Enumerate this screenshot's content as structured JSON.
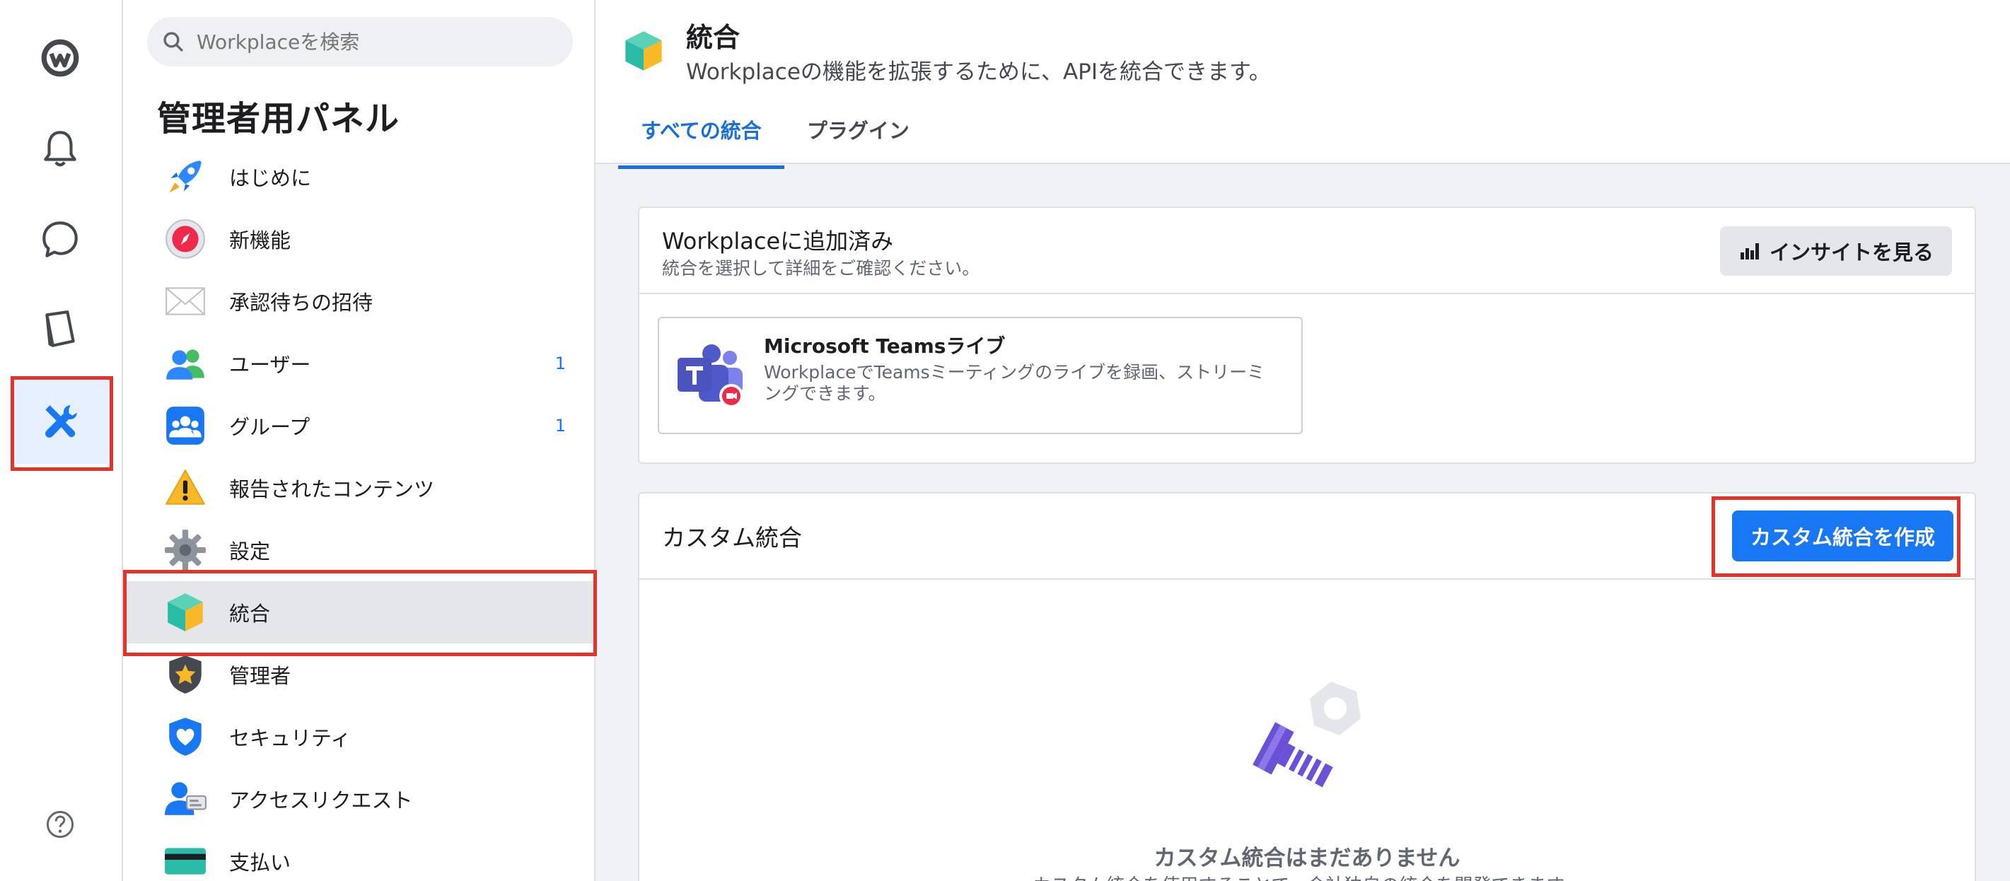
{
  "search": {
    "placeholder": "Workplaceを検索"
  },
  "sidebar": {
    "title": "管理者用パネル",
    "items": [
      {
        "label": "はじめに",
        "icon": "rocket-icon",
        "count": ""
      },
      {
        "label": "新機能",
        "icon": "compass-icon",
        "count": ""
      },
      {
        "label": "承認待ちの招待",
        "icon": "envelope-icon",
        "count": ""
      },
      {
        "label": "ユーザー",
        "icon": "users-icon",
        "count": "1"
      },
      {
        "label": "グループ",
        "icon": "group-icon",
        "count": "1"
      },
      {
        "label": "報告されたコンテンツ",
        "icon": "warning-icon",
        "count": ""
      },
      {
        "label": "設定",
        "icon": "gear-icon",
        "count": ""
      },
      {
        "label": "統合",
        "icon": "cube-icon",
        "count": ""
      },
      {
        "label": "管理者",
        "icon": "admin-shield-icon",
        "count": ""
      },
      {
        "label": "セキュリティ",
        "icon": "security-shield-icon",
        "count": ""
      },
      {
        "label": "アクセスリクエスト",
        "icon": "access-request-icon",
        "count": ""
      },
      {
        "label": "支払い",
        "icon": "card-icon",
        "count": ""
      }
    ]
  },
  "header": {
    "title": "統合",
    "subtitle": "Workplaceの機能を拡張するために、APIを統合できます。",
    "tabs": [
      "すべての統合",
      "プラグイン"
    ]
  },
  "added": {
    "title": "Workplaceに追加済み",
    "subtitle": "統合を選択して詳細をご確認ください。",
    "insights_button": "インサイトを見る",
    "integration": {
      "name": "Microsoft Teamsライブ",
      "description": "WorkplaceでTeamsミーティングのライブを録画、ストリーミングできます。"
    }
  },
  "custom": {
    "title": "カスタム統合",
    "create_button": "カスタム統合を作成",
    "empty_title": "カスタム統合はまだありません",
    "empty_sub": "カスタム統合を使用することで、会社独自の統合を開発できます。"
  },
  "colors": {
    "accent": "#1877f2",
    "highlight": "#e4332a"
  }
}
